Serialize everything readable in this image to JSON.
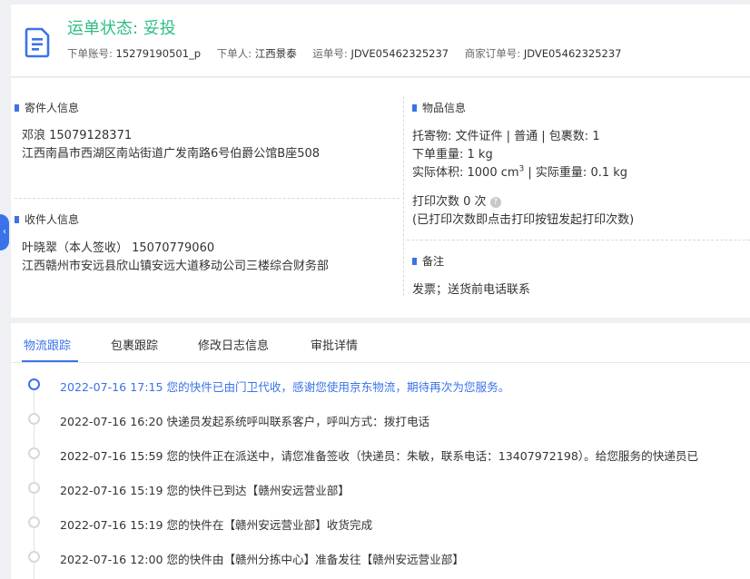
{
  "header": {
    "status_title": "运单状态: 妥投",
    "order_account_label": "下单账号:",
    "order_account_value": "15279190501_p",
    "orderer_label": "下单人:",
    "orderer_value": "江西景泰",
    "waybill_label": "运单号:",
    "waybill_value": "JDVE05462325237",
    "merchant_order_label": "商家订单号:",
    "merchant_order_value": "JDVE05462325237",
    "icon": "document-icon"
  },
  "sender": {
    "section_title": "寄件人信息",
    "name_phone": "邓浪   15079128371",
    "address": "江西南昌市西湖区南站街道广发南路6号伯爵公馆B座508"
  },
  "receiver": {
    "section_title": "收件人信息",
    "name_phone": "叶晓翠（本人签收）   15070779060",
    "address": "江西赣州市安远县欣山镇安远大道移动公司三楼综合财务部"
  },
  "goods": {
    "section_title": "物品信息",
    "items_line": "托寄物:  文件证件 | 普通  |  包裹数:   1",
    "weight_line": "下单重量:    1 kg",
    "volume_prefix": "实际体积:    1000 cm",
    "volume_sup": "3",
    "volume_suffix": " |  实际重量:    0.1 kg",
    "print_count_line": "打印次数    0 次",
    "print_hint": "(已打印次数即点击打印按钮发起打印次数)"
  },
  "remark": {
    "section_title": "备注",
    "content": "发票；送货前电话联系"
  },
  "tabs": [
    {
      "label": "物流跟踪"
    },
    {
      "label": "包裹跟踪"
    },
    {
      "label": "修改日志信息"
    },
    {
      "label": "审批详情"
    }
  ],
  "timeline": [
    {
      "text": "2022-07-16 17:15 您的快件已由门卫代收，感谢您使用京东物流，期待再次为您服务。",
      "active": true
    },
    {
      "text": "2022-07-16 16:20 快递员发起系统呼叫联系客户，呼叫方式：拨打电话",
      "active": false
    },
    {
      "text": "2022-07-16 15:59 您的快件正在派送中，请您准备签收（快递员：朱敏，联系电话：13407972198）。给您服务的快递员已",
      "active": false
    },
    {
      "text": "2022-07-16 15:19 您的快件已到达【赣州安远营业部】",
      "active": false
    },
    {
      "text": "2022-07-16 15:19 您的快件在【赣州安远营业部】收货完成",
      "active": false
    },
    {
      "text": "2022-07-16 12:00 您的快件由【赣州分拣中心】准备发往【赣州安远营业部】",
      "active": false
    }
  ],
  "colors": {
    "accent": "#3a73e8",
    "status_green": "#2dbe80"
  }
}
